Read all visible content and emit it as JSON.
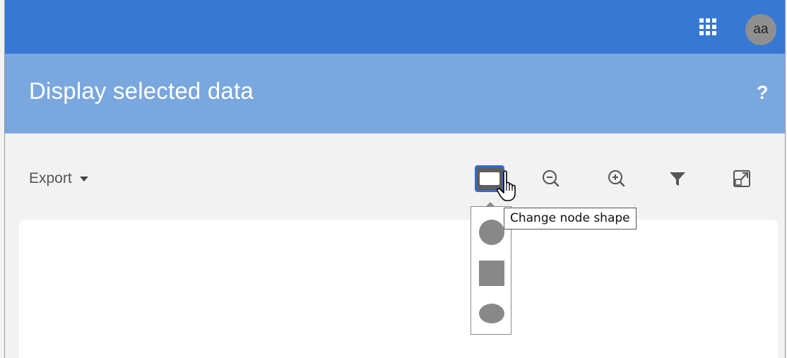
{
  "topbar": {
    "apps_icon": "apps-grid-icon",
    "avatar_initials": "aa"
  },
  "header": {
    "title": "Display selected data",
    "help_label": "?"
  },
  "toolbar": {
    "export_label": "Export",
    "tools": [
      {
        "name": "change-node-shape",
        "icon": "rectangle-shape-icon",
        "active": true
      },
      {
        "name": "zoom-out",
        "icon": "zoom-out-icon"
      },
      {
        "name": "zoom-in",
        "icon": "zoom-in-icon"
      },
      {
        "name": "filter",
        "icon": "filter-icon"
      },
      {
        "name": "fullscreen",
        "icon": "expand-icon"
      }
    ]
  },
  "shape_menu": {
    "options": [
      "circle",
      "square",
      "ellipse"
    ]
  },
  "tooltip": {
    "text": "Change node shape"
  },
  "colors": {
    "topbar": "#3778d3",
    "header": "#7aa7de",
    "accent": "#2f6fd0",
    "shape_fill": "#888888"
  }
}
